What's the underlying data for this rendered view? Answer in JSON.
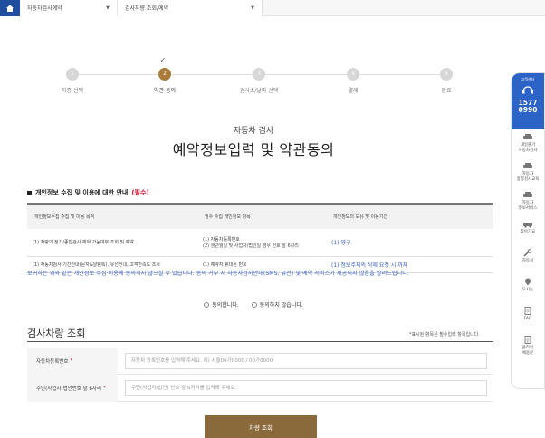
{
  "breadcrumb": {
    "item1": "자동차검사예약",
    "item2": "검사차량 조회/예약"
  },
  "stepper": {
    "steps": [
      {
        "num": "1",
        "label": "차종 선택"
      },
      {
        "num": "2",
        "label": "약관 동의"
      },
      {
        "num": "3",
        "label": "검사소/날짜 선택"
      },
      {
        "num": "4",
        "label": "결제"
      },
      {
        "num": "5",
        "label": "완료"
      }
    ],
    "active_index": 1
  },
  "header": {
    "subtitle": "자동차 검사",
    "title": "예약정보입력 및 약관동의"
  },
  "privacy": {
    "heading": "개인정보 수집 및 이용에 대한 안내",
    "required_tag": "(필수)",
    "columns": [
      "개인정보수집 수집 및 이용 목적",
      "필수 수집 개인정보 항목",
      "개인정보의 보유 및 이용기간"
    ],
    "rows": [
      {
        "purpose": "(1) 차량의 정기/종합검사 예약 가능여부 조회 및 예약",
        "items_line1": "(1) 자동차등록번호",
        "items_line2": "(2) 생년월일 및 사업자/법인일 경우 번호 앞 6자리",
        "period": "(1) 영구"
      },
      {
        "purpose": "(1) 자동차검사 기간안내(문자&알림톡), 유선안내, 고객만족도 조사",
        "items_line1": "(1) 예약자 휴대폰 번호",
        "items_line2": "",
        "period": "(1) 정보주체의 삭제 요청 시 까지"
      }
    ],
    "notice": "보귀하는 위와 같은 개인정보 수집·이용에 동의하지 않으실 수 있습니다. 동의 거부 시 자동차검사안내(SMS, 유선) 및 예약 서비스가 제공되지 않음을 알려드립니다.",
    "agree": "동의합니다.",
    "disagree": "동의하지 않습니다."
  },
  "lookup": {
    "title": "검사차량 조회",
    "required_note": "*표시된 항목은 필수입력 항목입니다.",
    "field1_label": "자동차등록번호",
    "field1_placeholder": "자동차 등록번호를 입력해 주세요. 예) 서울00가0000 / 00가0000",
    "field2_label": "주민(사업자)법인번호 앞 6자리",
    "field2_placeholder": "주민(사업자/법인) 번호 앞 6자리를 입력해 주세요.",
    "submit": "차량 조회"
  },
  "quick_menu": {
    "call_caption": "고객센터",
    "call_num1": "1577",
    "call_num2": "0990",
    "items": [
      {
        "line1": "내일출기",
        "line2": "자동차검사",
        "icon": "car-icon"
      },
      {
        "line1": "자동차",
        "line2": "종합검사교육",
        "icon": "car-icon"
      },
      {
        "line1": "자동차",
        "line2": "정보서비스",
        "icon": "car-icon"
      },
      {
        "line1": "찾아가요",
        "line2": "",
        "icon": "car-icon"
      },
      {
        "line1": "자동실",
        "line2": "",
        "icon": "wrench-icon"
      },
      {
        "line1": "오시는",
        "line2": "",
        "icon": "map-icon"
      },
      {
        "line1": "FAQ",
        "line2": "",
        "icon": "faq-icon"
      },
      {
        "line1": "온라인",
        "line2": "채용문",
        "icon": "doc-icon"
      }
    ]
  },
  "colors": {
    "accent_brown": "#8a6a3b",
    "step_active": "#a97c3a",
    "link_blue": "#3b62c4",
    "home_blue": "#1f4e9e",
    "call_blue": "#2c63c6",
    "required_red": "#c8102e"
  }
}
